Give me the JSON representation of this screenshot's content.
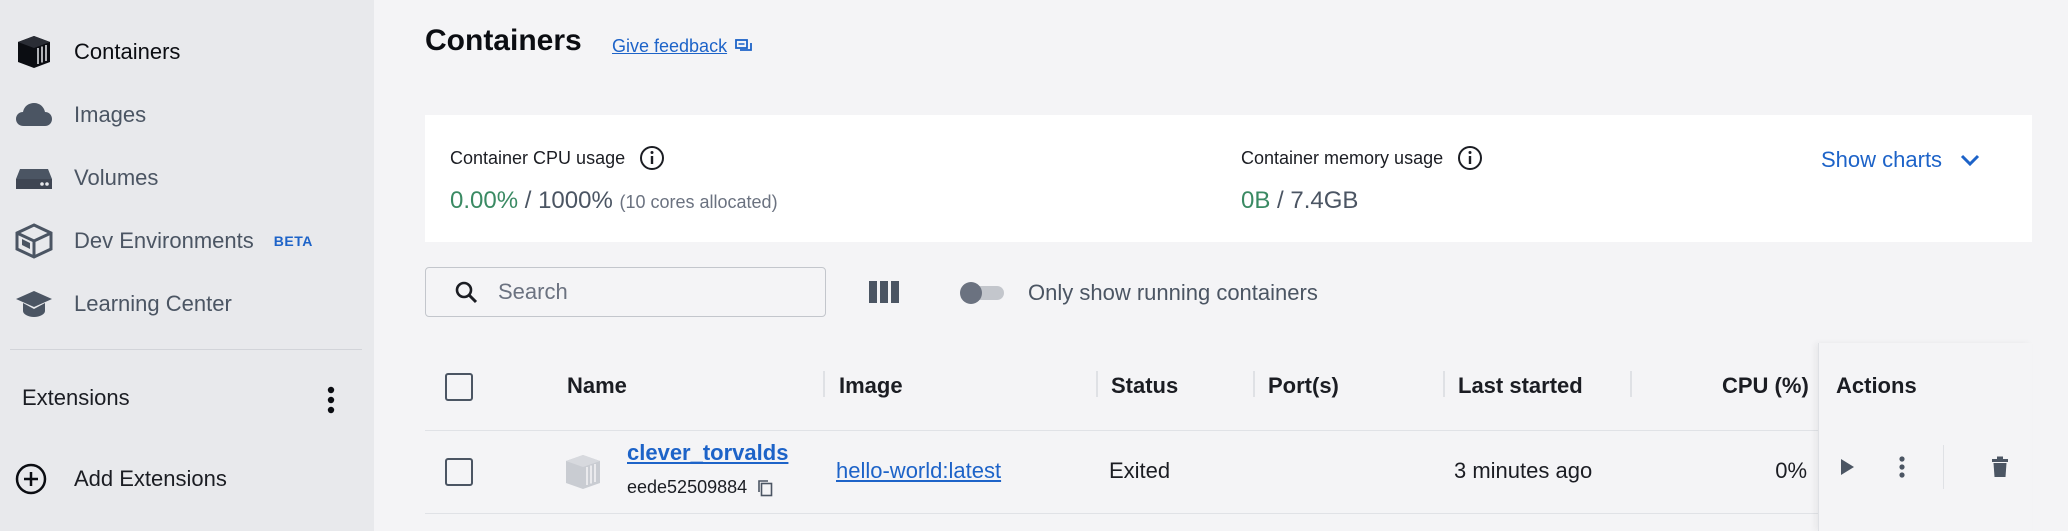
{
  "sidebar": {
    "items": [
      {
        "label": "Containers",
        "icon": "container-icon",
        "active": true
      },
      {
        "label": "Images",
        "icon": "cloud-icon"
      },
      {
        "label": "Volumes",
        "icon": "volume-drive-icon"
      },
      {
        "label": "Dev Environments",
        "icon": "dev-env-cube-icon",
        "badge": "BETA"
      },
      {
        "label": "Learning Center",
        "icon": "graduation-cap-icon"
      }
    ],
    "extensions_title": "Extensions",
    "add_extensions": "Add Extensions"
  },
  "header": {
    "title": "Containers",
    "feedback": "Give feedback"
  },
  "stats": {
    "cpu_label": "Container CPU usage",
    "cpu_used": "0.00%",
    "cpu_sep": " / ",
    "cpu_total": "1000%",
    "cpu_note": "(10 cores allocated)",
    "mem_label": "Container memory usage",
    "mem_used": "0B",
    "mem_sep": " / ",
    "mem_total": "7.4GB",
    "show_charts": "Show charts"
  },
  "toolbar": {
    "search_placeholder": "Search",
    "toggle_label": "Only show running containers",
    "toggle_on": false
  },
  "table": {
    "columns": [
      "Name",
      "Image",
      "Status",
      "Port(s)",
      "Last started",
      "CPU (%)",
      "Actions"
    ],
    "rows": [
      {
        "name": "clever_torvalds",
        "id": "eede52509884",
        "image": "hello-world:latest",
        "status": "Exited",
        "ports": "",
        "last_started": "3 minutes ago",
        "cpu": "0%"
      }
    ]
  },
  "colors": {
    "accent": "#1d63c8",
    "usage_green": "#3a8a63",
    "sidebar_bg": "#e8e9ec",
    "main_bg": "#f4f4f6"
  }
}
